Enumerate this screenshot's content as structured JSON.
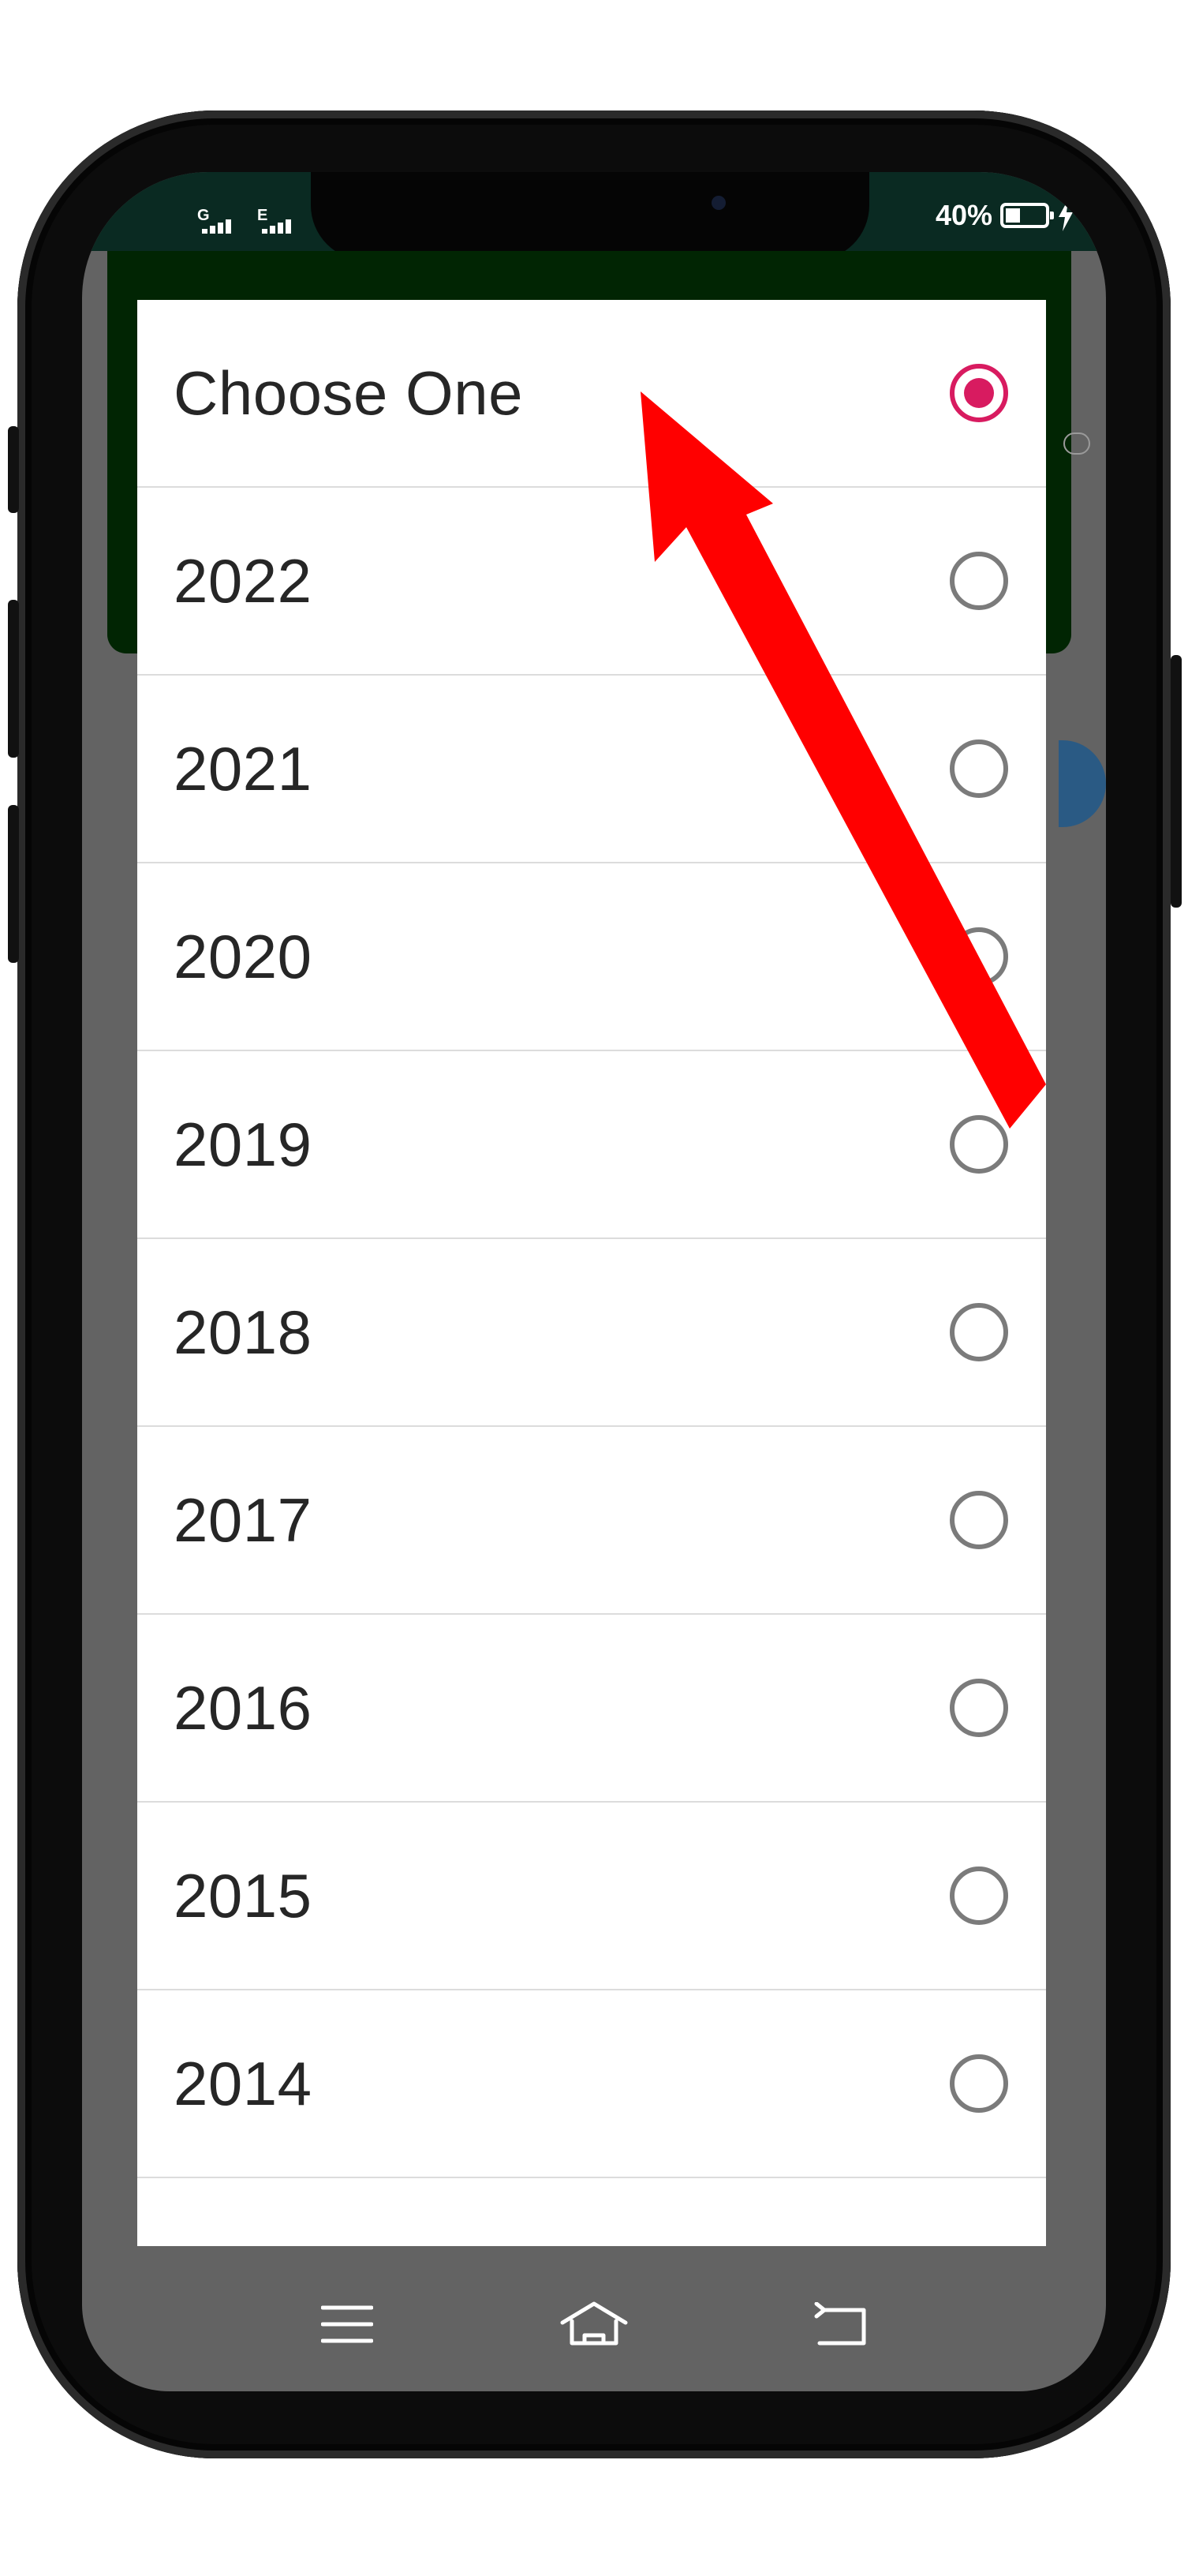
{
  "status_bar": {
    "network_1": "G",
    "network_2": "E",
    "battery_percent": "40%",
    "battery_level": 0.4,
    "charging": true
  },
  "dialog": {
    "selected_index": 0,
    "options": [
      {
        "label": "Choose One",
        "selected": true
      },
      {
        "label": "2022",
        "selected": false
      },
      {
        "label": "2021",
        "selected": false
      },
      {
        "label": "2020",
        "selected": false
      },
      {
        "label": "2019",
        "selected": false
      },
      {
        "label": "2018",
        "selected": false
      },
      {
        "label": "2017",
        "selected": false
      },
      {
        "label": "2016",
        "selected": false
      },
      {
        "label": "2015",
        "selected": false
      },
      {
        "label": "2014",
        "selected": false
      }
    ]
  },
  "nav_bar": {
    "icons": [
      "menu-icon",
      "home-icon",
      "back-icon"
    ]
  },
  "annotation": {
    "type": "arrow",
    "color": "#ff0000",
    "points_to": "Choose One"
  },
  "colors": {
    "accent": "#d81b60",
    "header_bg": "#012503",
    "scrim": "#636363"
  }
}
